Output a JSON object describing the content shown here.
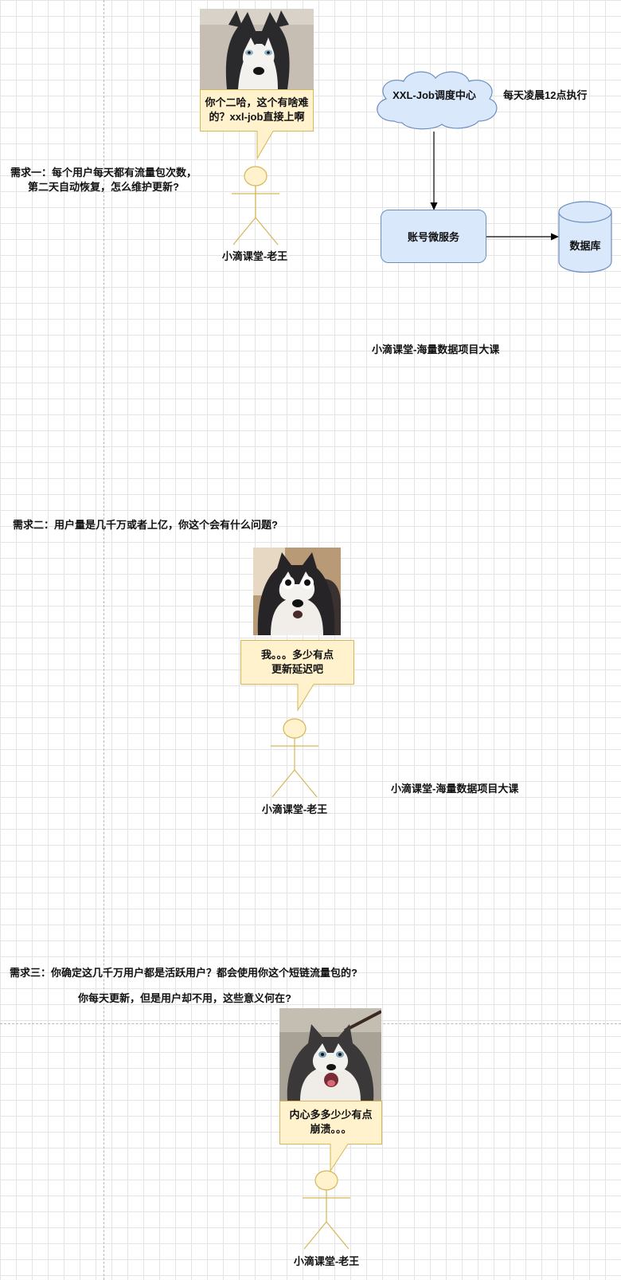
{
  "scene1": {
    "requirement_line1": "需求一：每个用户每天都有流量包次数，",
    "requirement_line2": "第二天自动恢复，怎么维护更新?",
    "bubble_line1": "你个二哈，这个有啥难",
    "bubble_line2": "的？xxl-job直接上啊",
    "actor_label": "小滴课堂-老王"
  },
  "flow": {
    "scheduler_label": "XXL-Job调度中心",
    "schedule_note": "每天凌晨12点执行",
    "service_label": "账号微服务",
    "database_label": "数据库",
    "watermark": "小滴课堂-海量数据项目大课"
  },
  "scene2": {
    "requirement": "需求二：用户量是几千万或者上亿，你这个会有什么问题?",
    "bubble_line1": "我。。。多少有点",
    "bubble_line2": "更新延迟吧",
    "actor_label": "小滴课堂-老王",
    "watermark": "小滴课堂-海量数据项目大课"
  },
  "scene3": {
    "requirement_line1": "需求三：你确定这几千万用户都是活跃用户？都会使用你这个短链流量包的?",
    "requirement_line2": "你每天更新，但是用户却不用，这些意义何在?",
    "bubble_line1": "内心多多少少有点",
    "bubble_line2": "崩溃。。。",
    "actor_label": "小滴课堂-老王"
  },
  "colors": {
    "bubble_fill": "#fff2cc",
    "bubble_stroke": "#d6b656",
    "node_fill": "#dae8fc",
    "node_stroke": "#6c8ebf",
    "actor_stroke": "#d6b656",
    "edge": "#000000"
  },
  "icons": [
    "husky-photo",
    "husky-shocked-photo",
    "husky-screaming-photo",
    "stick-figure-icon",
    "cloud-shape",
    "cylinder-shape",
    "arrow-connector"
  ]
}
